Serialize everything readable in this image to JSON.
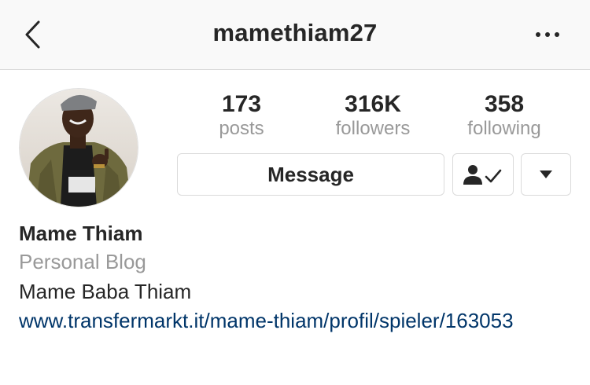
{
  "header": {
    "username": "mamethiam27",
    "back_icon": "chevron-left-icon",
    "more_icon": "more-horizontal-icon"
  },
  "stats": [
    {
      "value": "173",
      "label": "posts"
    },
    {
      "value": "316K",
      "label": "followers"
    },
    {
      "value": "358",
      "label": "following"
    }
  ],
  "actions": {
    "message_label": "Message",
    "following_icon": "user-check-icon",
    "dropdown_icon": "caret-down-icon"
  },
  "bio": {
    "name": "Mame Thiam",
    "category": "Personal Blog",
    "full_name": "Mame Baba Thiam",
    "link": "www.transfermarkt.it/mame-thiam/profil/spieler/163053"
  },
  "colors": {
    "link": "#003569",
    "muted": "#999999",
    "text": "#262626",
    "border": "#dbdbdb"
  }
}
